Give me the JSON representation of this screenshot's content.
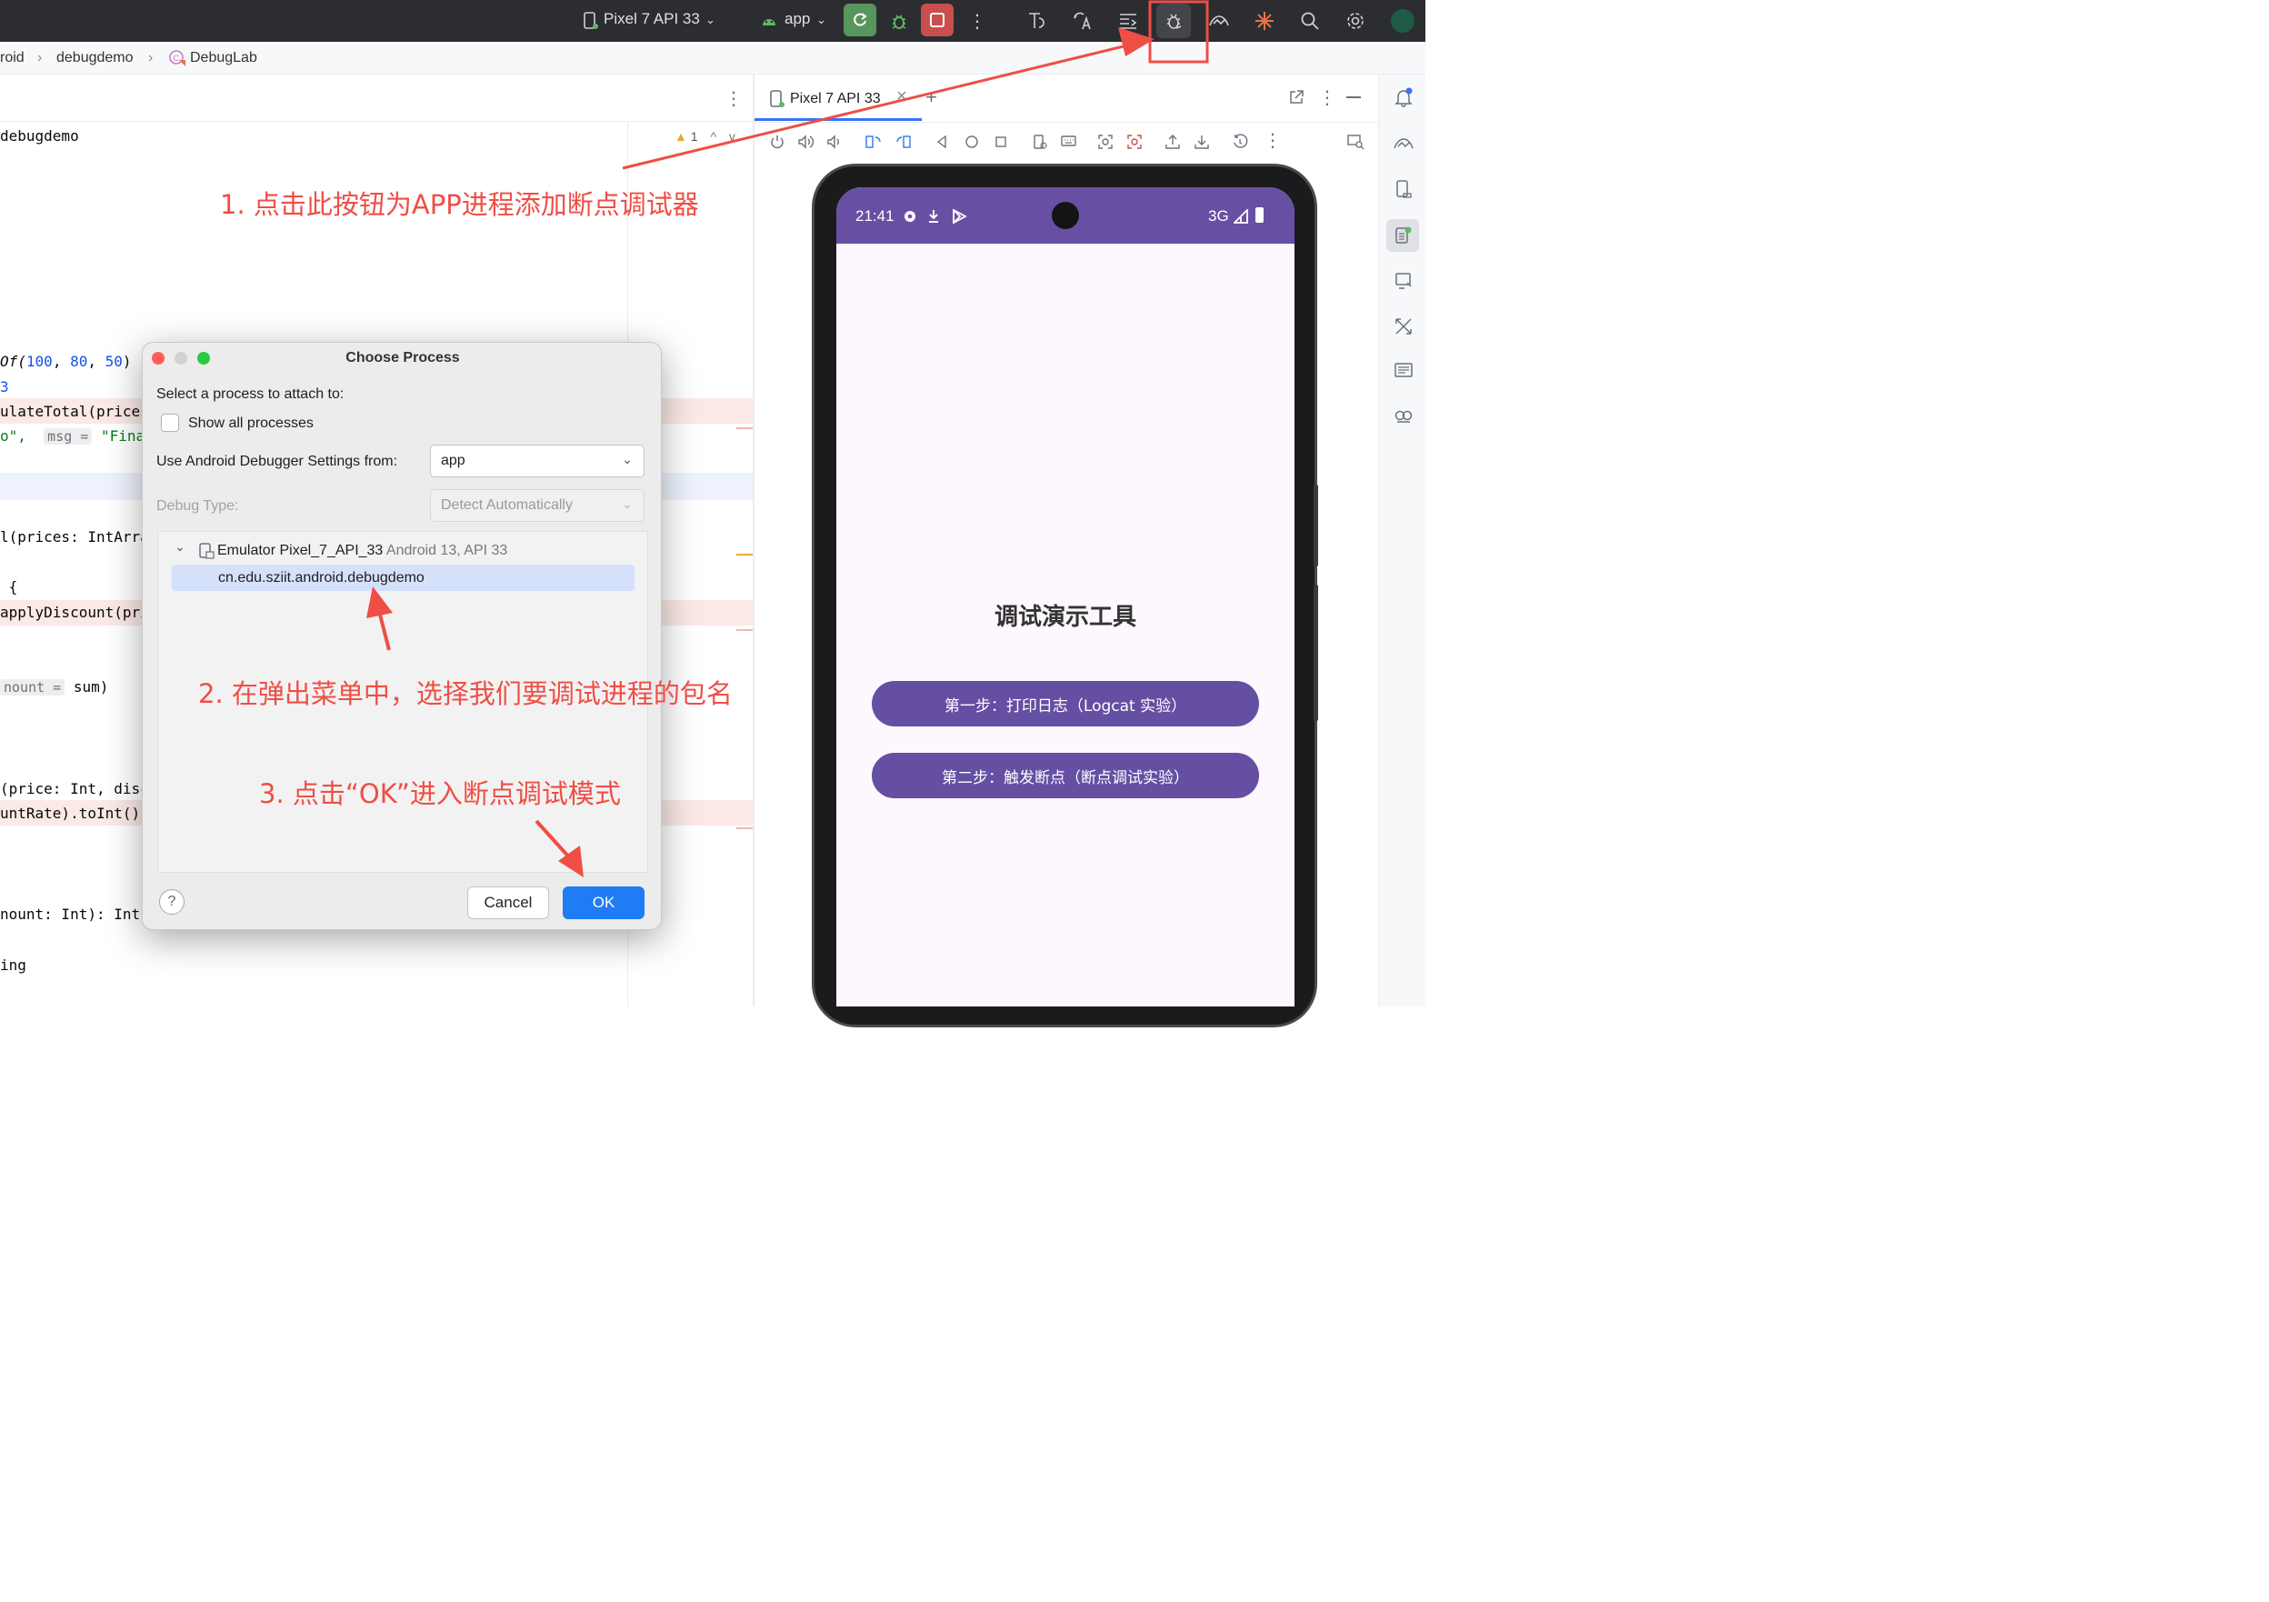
{
  "toolbar": {
    "device": "Pixel 7 API 33",
    "run_config": "app"
  },
  "breadcrumb": {
    "items": [
      "roid",
      "debugdemo",
      "DebugLab"
    ]
  },
  "editor": {
    "problems_count": "1",
    "lines": [
      {
        "text": "debugdemo"
      },
      {
        "pre": "Of(",
        "n1": "100",
        "sep1": ", ",
        "n2": "80",
        "sep2": ", ",
        "n3": "50",
        "post": ")"
      },
      {
        "text": "3"
      },
      {
        "text": "ulateTotal(prices"
      },
      {
        "pre": "o\", ",
        "hint": "msg =",
        "str": "\"Final"
      },
      {
        "text": "l(prices: IntArra"
      },
      {
        "text": " {"
      },
      {
        "text": "applyDiscount(pri"
      },
      {
        "hint": "nount =",
        "post": " sum)"
      },
      {
        "text": "(price: Int, disc"
      },
      {
        "text": "untRate).toInt()"
      },
      {
        "text": "nount: Int): Int"
      },
      {
        "text": "ing"
      }
    ]
  },
  "running_devices": {
    "tab": "Pixel 7 API 33"
  },
  "phone": {
    "time": "21:41",
    "network": "3G",
    "title": "调试演示工具",
    "button1": "第一步：打印日志（Logcat 实验）",
    "button2": "第二步：触发断点（断点调试实验）"
  },
  "dialog": {
    "title": "Choose Process",
    "prompt": "Select a process to attach to:",
    "show_all": "Show all processes",
    "settings_label": "Use Android Debugger Settings from:",
    "settings_value": "app",
    "debug_type_label": "Debug Type:",
    "debug_type_value": "Detect Automatically",
    "device_name": "Emulator Pixel_7_API_33",
    "device_detail": "Android 13, API 33",
    "process": "cn.edu.sziit.android.debugdemo",
    "help": "?",
    "cancel": "Cancel",
    "ok": "OK"
  },
  "annotations": {
    "step1": "1. 点击此按钮为APP进程添加断点调试器",
    "step2": "2. 在弹出菜单中，选择我们要调试进程的包名",
    "step3": "3. 点击“OK”进入断点调试模式"
  },
  "colors": {
    "annotation": "#ef4e45",
    "ok_button": "#1f7cf4",
    "app_purple": "#6750a4",
    "ide_toolbar": "#2b2d30"
  }
}
